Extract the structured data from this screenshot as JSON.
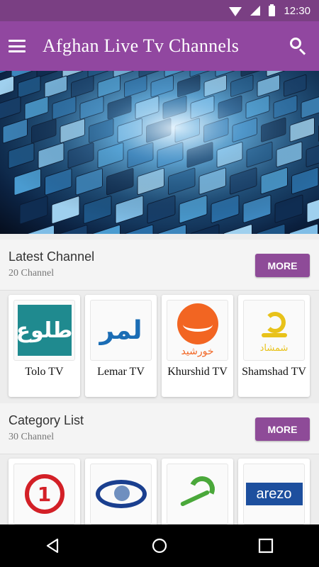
{
  "status_bar": {
    "time": "12:30"
  },
  "app_bar": {
    "title": "Afghan Live Tv Channels"
  },
  "latest": {
    "title": "Latest Channel",
    "count": "20 Channel",
    "more_label": "MORE",
    "channels": [
      {
        "name": "Tolo TV",
        "logo_text": "طلوع",
        "color": "#1f8a8f"
      },
      {
        "name": "Lemar TV",
        "logo_text": "لمر",
        "color": "#1b6db5"
      },
      {
        "name": "Khurshid TV",
        "logo_text": "خورشید",
        "color": "#f26522"
      },
      {
        "name": "Shamshad TV",
        "logo_text": "شمشاد",
        "color": "#e8c21a"
      }
    ]
  },
  "category": {
    "title": "Category List",
    "count": "30 Channel",
    "more_label": "MORE",
    "channels": [
      {
        "logo_text": "1",
        "color": "#d32027"
      },
      {
        "logo_text": "",
        "color": "#1a3f8f"
      },
      {
        "logo_text": "",
        "color": "#4aa83a"
      },
      {
        "logo_text": "arezo",
        "color": "#1d4f9e"
      }
    ]
  },
  "colors": {
    "status_bar": "#7a3f83",
    "app_bar": "#9147a0",
    "button": "#8e4b98"
  }
}
